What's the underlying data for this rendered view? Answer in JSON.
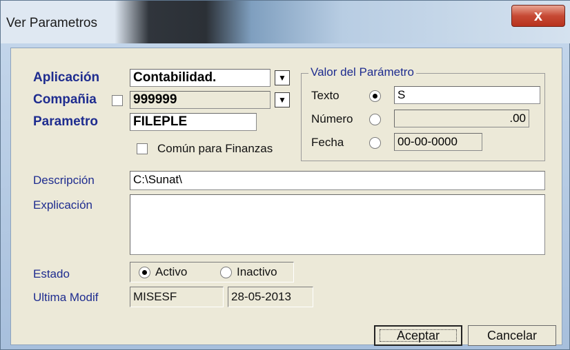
{
  "window": {
    "title": "Ver Parametros",
    "close_glyph": "x"
  },
  "form": {
    "aplicacion_label": "Aplicación",
    "aplicacion_value": "Contabilidad.",
    "compania_label": "Compañia",
    "compania_value": "999999",
    "parametro_label": "Parametro",
    "parametro_value": "FILEPLE",
    "comun_label": "Común para Finanzas",
    "descripcion_label": "Descripción",
    "descripcion_value": "C:\\Sunat\\",
    "explicacion_label": "Explicación",
    "explicacion_value": "",
    "estado_label": "Estado",
    "estado_activo": "Activo",
    "estado_inactivo": "Inactivo",
    "estado_selected": "Activo",
    "ultima_label": "Ultima Modif",
    "ultima_user": "MISESF",
    "ultima_date": "28-05-2013"
  },
  "valor": {
    "group_label": "Valor del Parámetro",
    "texto_label": "Texto",
    "texto_value": "S",
    "numero_label": "Número",
    "numero_value": ".00",
    "fecha_label": "Fecha",
    "fecha_value": "00-00-0000",
    "selected": "Texto"
  },
  "buttons": {
    "aceptar": "Aceptar",
    "cancelar": "Cancelar"
  },
  "colors": {
    "label_blue": "#1e2c8f",
    "dialog_bg": "#ece9d8",
    "close_red": "#c74a35"
  }
}
